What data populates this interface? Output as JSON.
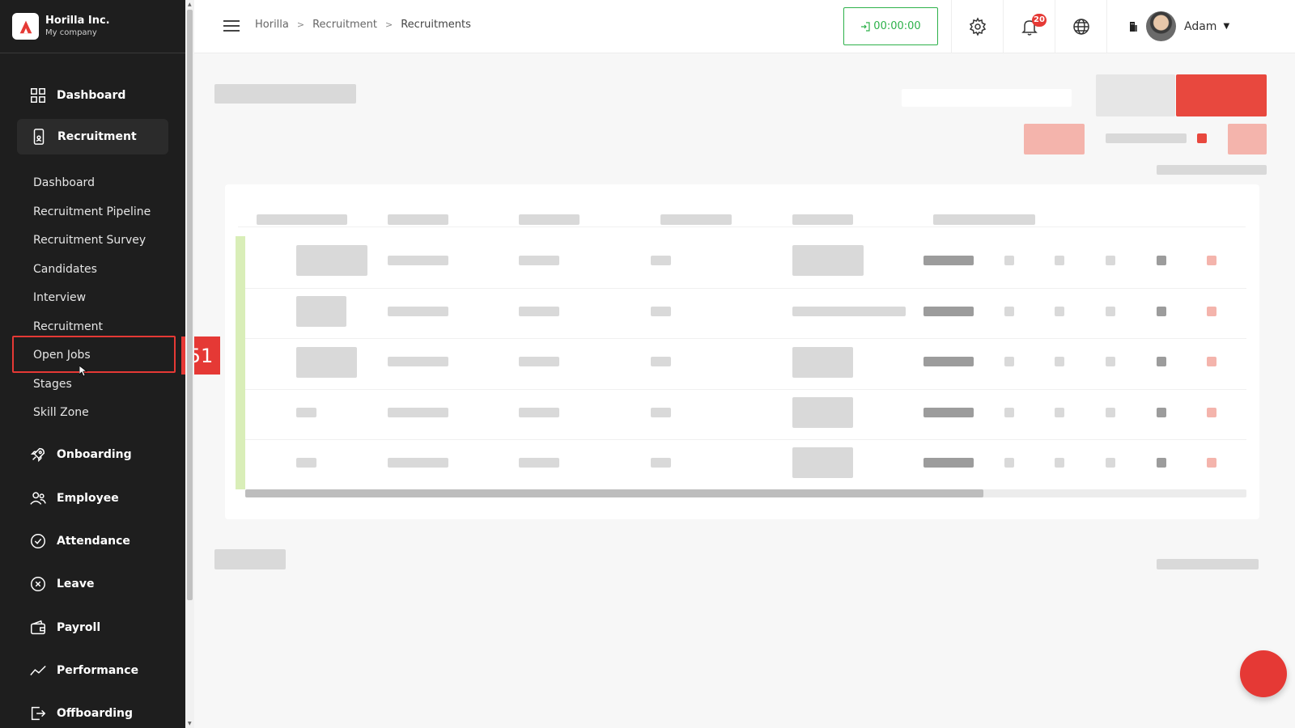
{
  "brand": {
    "name": "Horilla Inc.",
    "subtitle": "My company"
  },
  "sidebar": {
    "main_items": [
      {
        "label": "Dashboard",
        "icon": "dashboard-grid-icon"
      },
      {
        "label": "Recruitment",
        "icon": "recruitment-phone-icon",
        "active": true
      },
      {
        "label": "Onboarding",
        "icon": "rocket-icon"
      },
      {
        "label": "Employee",
        "icon": "users-icon"
      },
      {
        "label": "Attendance",
        "icon": "check-circle-icon"
      },
      {
        "label": "Leave",
        "icon": "x-circle-icon"
      },
      {
        "label": "Payroll",
        "icon": "wallet-icon"
      },
      {
        "label": "Performance",
        "icon": "trend-line-icon"
      },
      {
        "label": "Offboarding",
        "icon": "exit-icon"
      }
    ],
    "recruitment_submenu": [
      "Dashboard",
      "Recruitment Pipeline",
      "Recruitment Survey",
      "Candidates",
      "Interview",
      "Recruitment",
      "Open Jobs",
      "Stages",
      "Skill Zone"
    ],
    "highlight_badge": "51"
  },
  "header": {
    "breadcrumb": [
      "Horilla",
      "Recruitment",
      "Recruitments"
    ],
    "timer": "00:00:00",
    "notification_count": "20",
    "user_name": "Adam",
    "icons": [
      "settings-gear-icon",
      "bell-icon",
      "globe-icon",
      "building-icon"
    ]
  },
  "colors": {
    "sidebar_bg": "#1e1e1e",
    "accent_red": "#e53935",
    "timer_green": "#2db14a"
  }
}
